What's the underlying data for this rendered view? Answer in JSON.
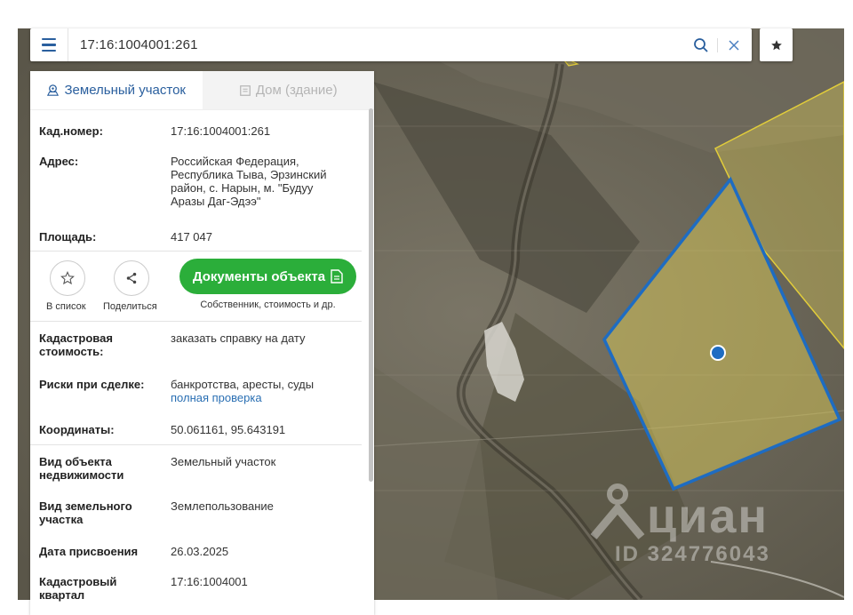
{
  "search": {
    "value": "17:16:1004001:261"
  },
  "tabs": [
    {
      "label": "Земельный участок",
      "icon": "land-plot-icon",
      "active": true
    },
    {
      "label": "Дом (здание)",
      "icon": "building-icon",
      "active": false
    }
  ],
  "info": {
    "cad_number_label": "Кад.номер:",
    "cad_number_value": "17:16:1004001:261",
    "address_label": "Адрес:",
    "address_value": "Российская Федерация, Республика Тыва, Эрзинский район, с. Нарын, м. \"Будуу Аразы Даг-Эдээ\"",
    "area_label": "Площадь:",
    "area_value": "417 047",
    "cad_cost_label": "Кадастровая стоимость:",
    "cad_cost_link": "заказать справку на дату",
    "risks_label": "Риски при сделке:",
    "risks_value": "банкротства, аресты, суды",
    "risks_link": "полная проверка",
    "coords_label": "Координаты:",
    "coords_value": "50.061161, 95.643191",
    "object_type_label": "Вид объекта недвижимости",
    "object_type_value": "Земельный участок",
    "land_type_label": "Вид земельного участка",
    "land_type_value": "Землепользование",
    "assign_date_label": "Дата присвоения",
    "assign_date_value": "26.03.2025",
    "cad_quarter_label": "Кадастровый квартал",
    "cad_quarter_value": "17:16:1004001"
  },
  "actions": {
    "favorite_label": "В список",
    "share_label": "Поделиться",
    "docs_button": "Документы объекта",
    "docs_sub": "Собственник, стоимость и др."
  },
  "watermark": {
    "brand": "циан",
    "id_text": "ID 324776043"
  },
  "colors": {
    "accent": "#2a5f9e",
    "link": "#2a6fb3",
    "docs_button": "#2bae3a",
    "parcel_border": "#1e6cc2",
    "parcel_fill": "#e8d65a"
  }
}
